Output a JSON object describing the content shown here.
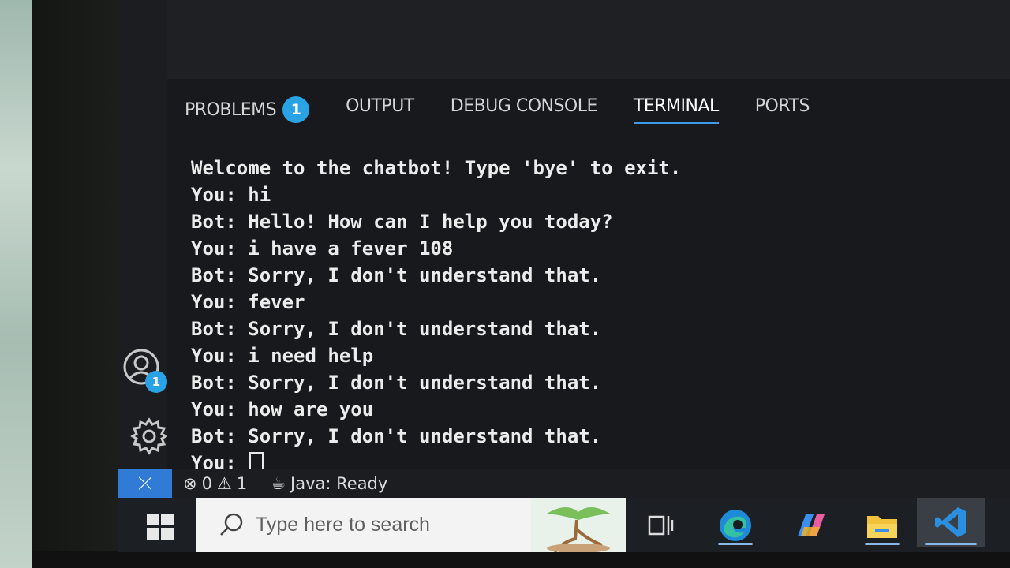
{
  "panel": {
    "tabs": [
      {
        "label": "PROBLEMS",
        "badge": "1",
        "active": false
      },
      {
        "label": "OUTPUT",
        "active": false
      },
      {
        "label": "DEBUG CONSOLE",
        "active": false
      },
      {
        "label": "TERMINAL",
        "active": true
      },
      {
        "label": "PORTS",
        "active": false
      }
    ]
  },
  "terminal": {
    "lines": [
      "Welcome to the chatbot! Type 'bye' to exit.",
      "You: hi",
      "Bot: Hello! How can I help you today?",
      "You: i have a fever 108",
      "Bot: Sorry, I don't understand that.",
      "You: fever",
      "Bot: Sorry, I don't understand that.",
      "You: i need help",
      "Bot: Sorry, I don't understand that.",
      "You: how are you",
      "Bot: Sorry, I don't understand that."
    ],
    "prompt": "You: "
  },
  "activity_bar": {
    "accounts_badge": "1",
    "icons": [
      "accounts-icon",
      "gear-icon"
    ]
  },
  "status_bar": {
    "errors": "0",
    "warnings": "1",
    "java_status": "Java: Ready"
  },
  "taskbar": {
    "search_placeholder": "Type here to search",
    "apps": [
      "task-view-icon",
      "edge-icon",
      "copilot-icon",
      "file-explorer-icon",
      "vscode-icon"
    ]
  },
  "colors": {
    "accent": "#2aa3e6",
    "remote_indicator": "#2f7bd6",
    "terminal_text": "#ececec"
  }
}
